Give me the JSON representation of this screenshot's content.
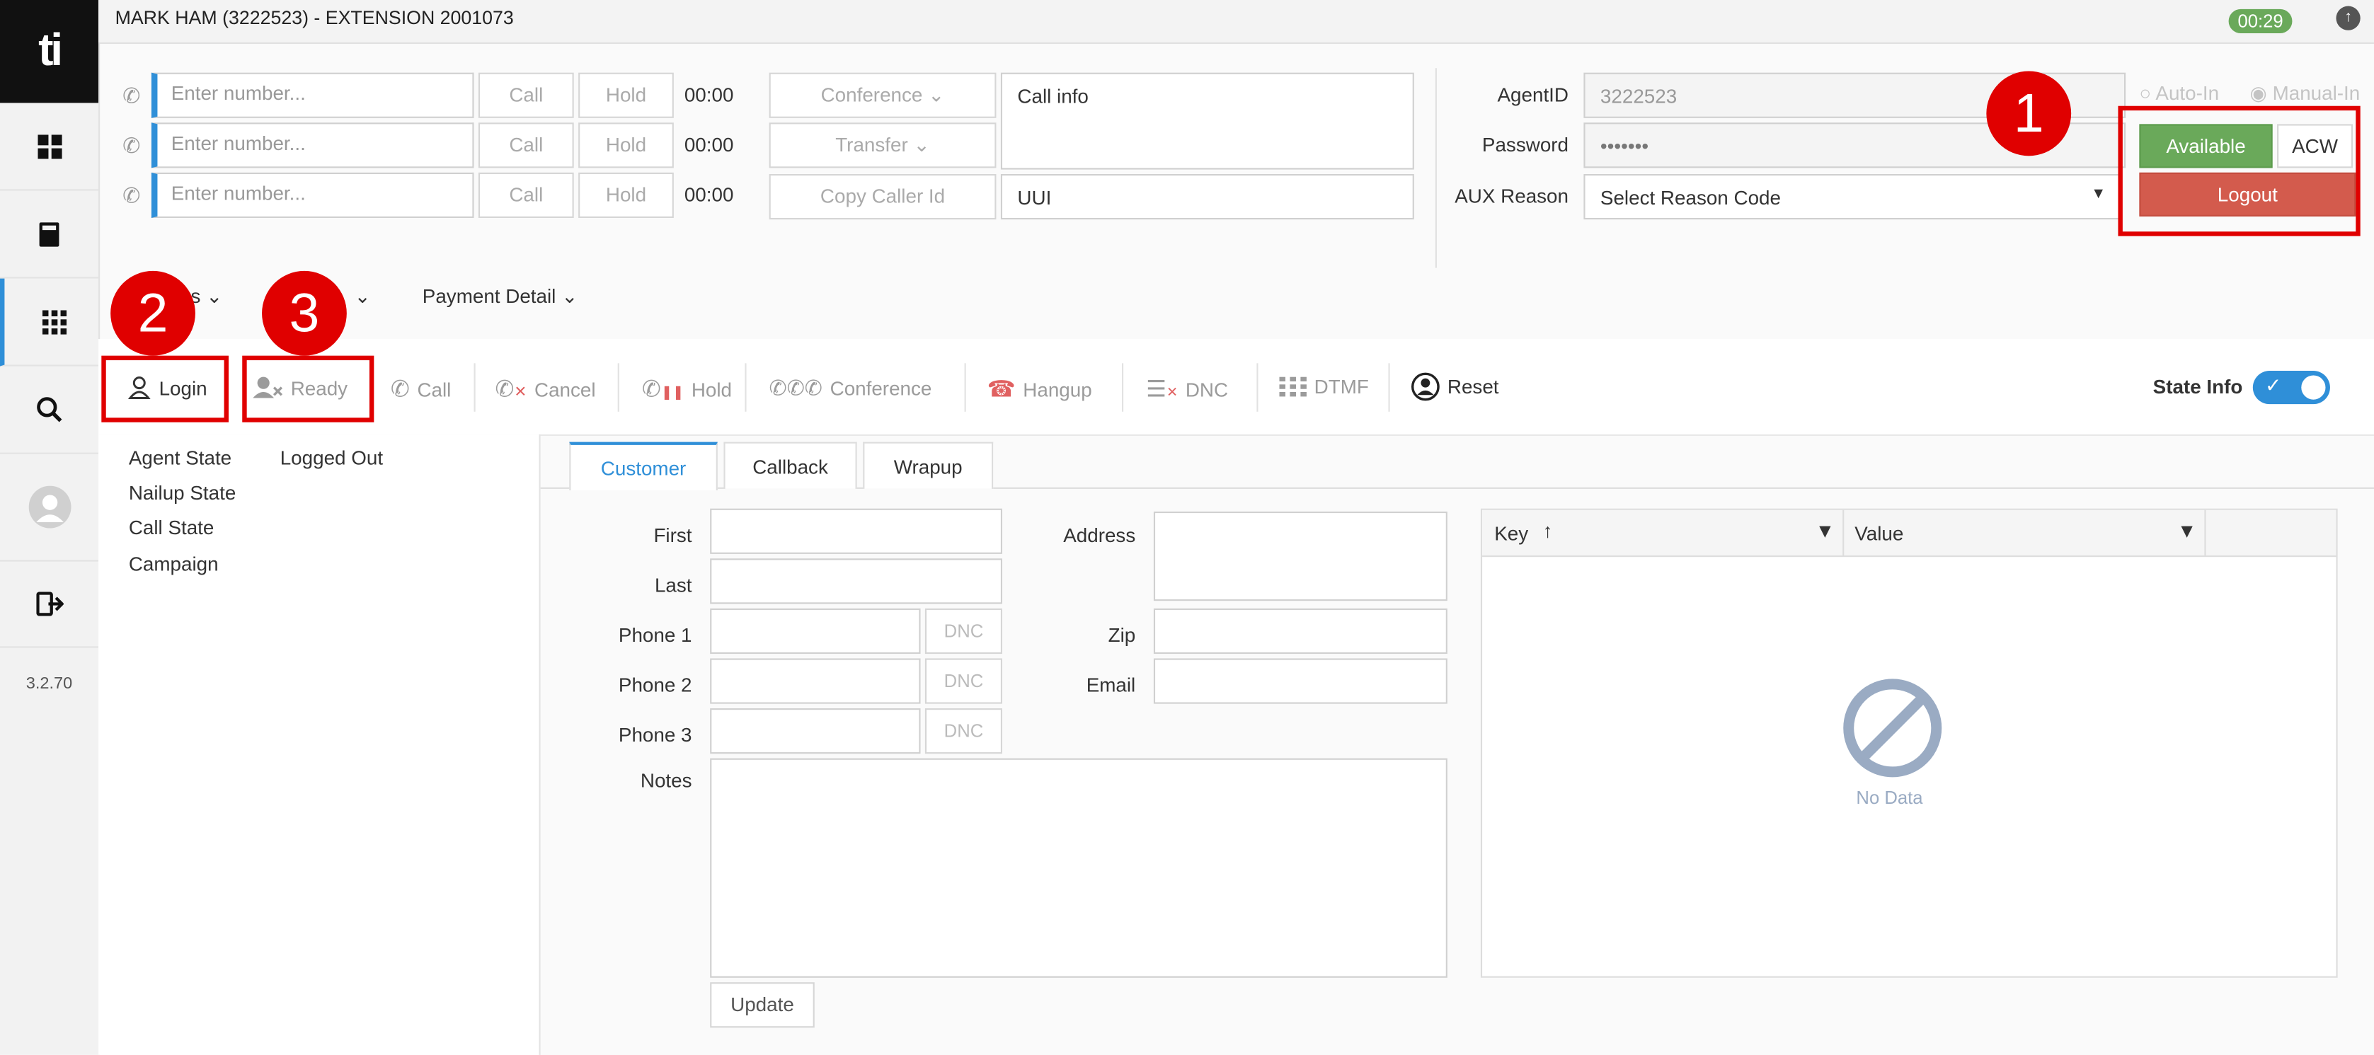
{
  "version": "3.2.70",
  "header": {
    "title": "MARK HAM (3222523) - EXTENSION 2001073",
    "timer": "00:29"
  },
  "phone": {
    "placeholder": "Enter number...",
    "call_label": "Call",
    "hold_label": "Hold",
    "times": [
      "00:00",
      "00:00",
      "00:00"
    ],
    "conference_label": "Conference",
    "transfer_label": "Transfer",
    "copy_caller_label": "Copy Caller Id",
    "call_info_label": "Call info",
    "uui_label": "UUI"
  },
  "agent": {
    "agentid_label": "AgentID",
    "agentid_value": "3222523",
    "password_label": "Password",
    "password_value": "•••••••",
    "aux_label": "AUX Reason",
    "aux_value": "Select Reason Code",
    "auto_in": "Auto-In",
    "manual_in": "Manual-In",
    "available": "Available",
    "acw": "ACW",
    "logout": "Logout"
  },
  "sections": {
    "visible_fragment": "s",
    "payment": "Payment Detail"
  },
  "toolbar": {
    "login": "Login",
    "ready": "Ready",
    "call": "Call",
    "cancel": "Cancel",
    "hold": "Hold",
    "conference": "Conference",
    "hangup": "Hangup",
    "dnc": "DNC",
    "dtmf": "DTMF",
    "reset": "Reset",
    "state_info": "State Info"
  },
  "state": {
    "agent_state_label": "Agent State",
    "agent_state_value": "Logged Out",
    "nailup_label": "Nailup State",
    "call_state_label": "Call State",
    "campaign_label": "Campaign"
  },
  "tabs": [
    "Customer",
    "Callback",
    "Wrapup"
  ],
  "form": {
    "first": "First",
    "last": "Last",
    "phone1": "Phone 1",
    "phone2": "Phone 2",
    "phone3": "Phone 3",
    "dnc": "DNC",
    "notes": "Notes",
    "address": "Address",
    "zip": "Zip",
    "email": "Email",
    "update": "Update"
  },
  "grid": {
    "key": "Key",
    "value": "Value",
    "empty": "No Data"
  },
  "annotations": [
    "1",
    "2",
    "3"
  ],
  "colors": {
    "accent": "#2f8fd8",
    "available": "#6aa95a",
    "logout": "#d35b4d",
    "annotation": "#e00000"
  }
}
